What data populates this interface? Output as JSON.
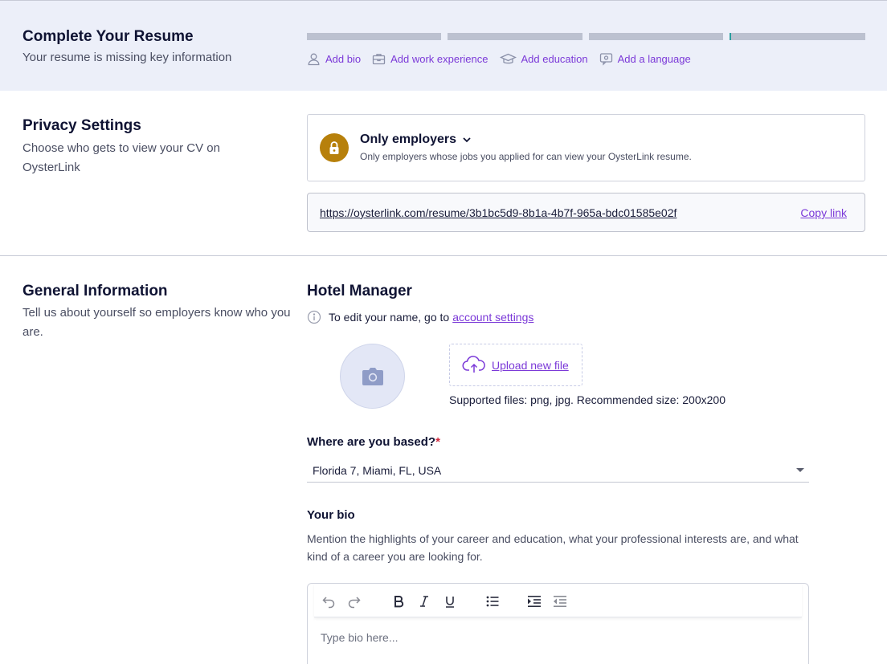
{
  "banner": {
    "title": "Complete Your Resume",
    "subtitle": "Your resume is missing key information",
    "progress_segments": 4,
    "links": [
      {
        "label": "Add bio",
        "icon": "user-icon"
      },
      {
        "label": "Add work experience",
        "icon": "briefcase-icon"
      },
      {
        "label": "Add education",
        "icon": "graduation-cap-icon"
      },
      {
        "label": "Add a language",
        "icon": "language-chat-icon"
      }
    ]
  },
  "privacy": {
    "title": "Privacy Settings",
    "description": "Choose who gets to view your CV on OysterLink",
    "selected": "Only employers",
    "help": "Only employers whose jobs you applied for can view your OysterLink resume.",
    "url": "https://oysterlink.com/resume/3b1bc5d9-8b1a-4b7f-965a-bdc01585e02f",
    "copy_label": "Copy link",
    "lock_color": "#b7800b"
  },
  "general": {
    "title": "General Information",
    "description": "Tell us about yourself so employers know who you are.",
    "name": "Hotel Manager",
    "name_note": "To edit your name, go to",
    "account_link": "account settings",
    "upload_label": "Upload new file",
    "upload_note": "Supported files: png, jpg. Recommended size: 200x200",
    "based_label": "Where are you based?",
    "based_required": "*",
    "based_value": "Florida 7, Miami, FL, USA",
    "bio_label": "Your bio",
    "bio_description": "Mention the highlights of your career and education, what your professional interests are, and what kind of a career you are looking for.",
    "bio_placeholder": "Type bio here..."
  },
  "accent_color": "#7b39d8"
}
